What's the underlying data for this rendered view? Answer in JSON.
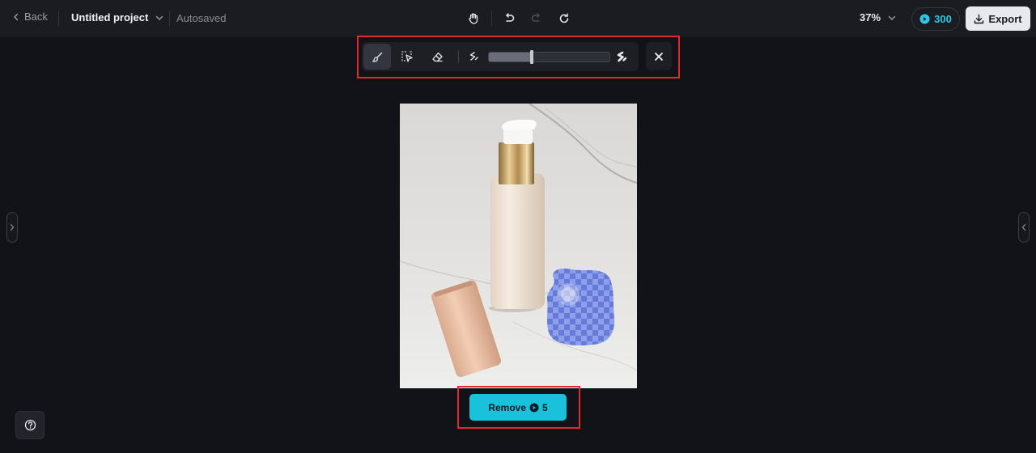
{
  "header": {
    "back_label": "Back",
    "project_title": "Untitled project",
    "save_status": "Autosaved",
    "zoom_level": "37%",
    "credits": "300",
    "export_label": "Export"
  },
  "brush_toolbar": {
    "active_tool": "brush",
    "brush_size_fraction": 0.36
  },
  "actions": {
    "remove_label": "Remove",
    "remove_cost": "5"
  },
  "colors": {
    "accent": "#19c2da",
    "highlight": "#e3282e",
    "mask": "#5470e6"
  },
  "icons": [
    "chevron-left-icon",
    "chevron-down-icon",
    "hand-icon",
    "undo-icon",
    "redo-icon",
    "refresh-icon",
    "credit-coin-icon",
    "download-icon",
    "brush-icon",
    "lasso-select-icon",
    "eraser-icon",
    "brush-small-icon",
    "brush-large-icon",
    "close-icon",
    "help-icon"
  ]
}
